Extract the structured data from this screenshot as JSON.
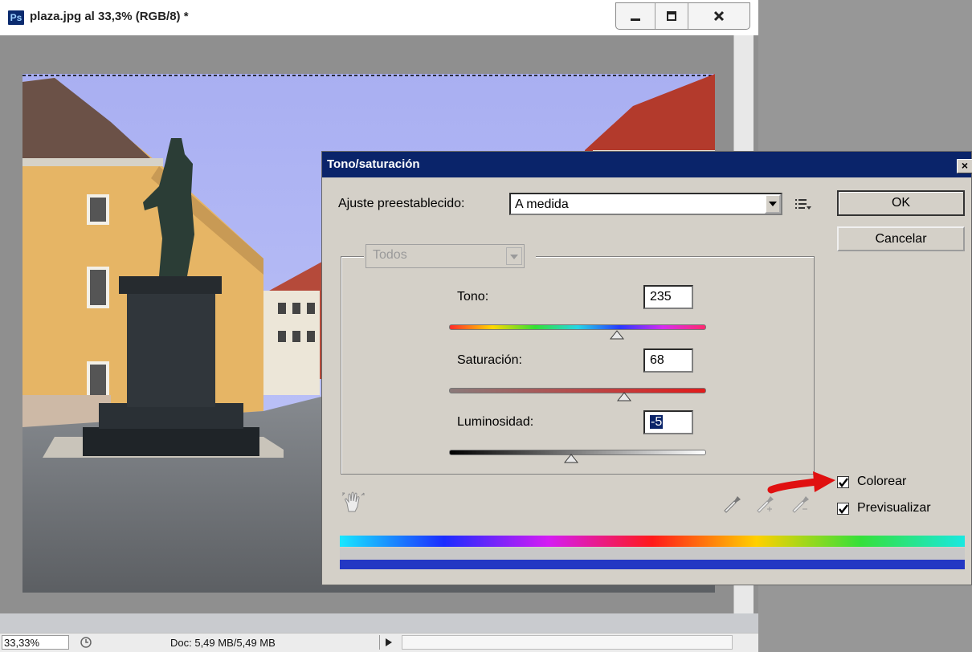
{
  "document": {
    "app_logo": "Ps",
    "title": "plaza.jpg al 33,3% (RGB/8) *",
    "window_buttons": [
      "minimize-icon",
      "maximize-icon",
      "close-icon"
    ],
    "status": {
      "zoom": "33,33%",
      "doc_info": "Doc: 5,49 MB/5,49 MB"
    }
  },
  "dialog": {
    "title": "Tono/saturación",
    "close_label": "×",
    "preset_label": "Ajuste preestablecido:",
    "preset_value": "A medida",
    "ok_label": "OK",
    "cancel_label": "Cancelar",
    "channel_value": "Todos",
    "hue": {
      "label": "Tono:",
      "value": "235",
      "range": [
        0,
        360
      ]
    },
    "saturation": {
      "label": "Saturación:",
      "value": "68",
      "range": [
        0,
        100
      ]
    },
    "lightness": {
      "label": "Luminosidad:",
      "value": "-5",
      "range": [
        -100,
        100
      ]
    },
    "colorize": {
      "label": "Colorear",
      "checked": true
    },
    "preview": {
      "label": "Previsualizar",
      "checked": true
    },
    "colors": {
      "titlebar": "#0a246a",
      "dialog_bg": "#d4d0c8",
      "colorized_bar": "#2338c4",
      "annotation_arrow": "#e01010"
    }
  }
}
